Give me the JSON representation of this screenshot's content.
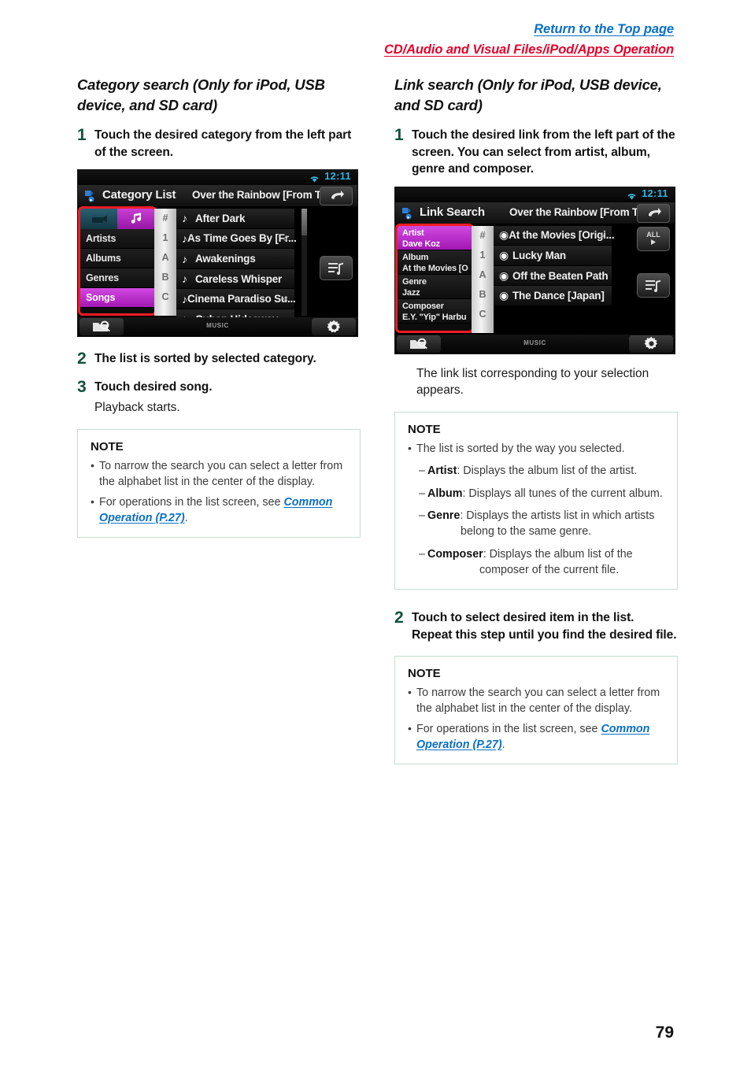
{
  "header": {
    "top_link": "Return to the Top page",
    "breadcrumb": "CD/Audio and Visual Files/iPod/Apps Operation"
  },
  "page_number": "79",
  "colors": {
    "link_blue": "#0b6fc4",
    "breadcrumb_red": "#e4002b",
    "step_number_green": "#12503c",
    "note_border_green": "#c9ddd0",
    "highlight_red": "#ee1c25",
    "device_accent_magenta": "#c93fd4"
  },
  "left_column": {
    "title": "Category search (Only for iPod, USB device, and SD card)",
    "steps": [
      {
        "num": "1",
        "text": "Touch the desired category from the left part of the screen."
      },
      {
        "num": "2",
        "text": "The list is sorted by selected category."
      },
      {
        "num": "3",
        "text": "Touch desired song.",
        "sub": "Playback starts."
      }
    ],
    "device": {
      "clock": "12:11",
      "title": "Category List",
      "now_playing": "Over the Rainbow [From T",
      "categories": [
        "Artists",
        "Albums",
        "Genres",
        "Songs"
      ],
      "selected_category": "Songs",
      "alphabet": [
        "#",
        "1",
        "A",
        "B",
        "C"
      ],
      "songs": [
        {
          "label": "After Dark",
          "chevron": false
        },
        {
          "label": "As Time Goes By [Fr...",
          "chevron": true
        },
        {
          "label": "Awakenings",
          "chevron": false
        },
        {
          "label": "Careless Whisper",
          "chevron": false
        },
        {
          "label": "Cinema Paradiso Su...",
          "chevron": true
        },
        {
          "label": "Cuban Hideaway",
          "chevron": false
        }
      ],
      "bottom_label": "MUSIC"
    },
    "note": {
      "title": "NOTE",
      "items": [
        {
          "text": "To narrow the search you can select a letter from the alphabet list in the center of the display."
        },
        {
          "pre": "For operations in the list screen, see ",
          "link": "Common Operation (P.27)",
          "post": "."
        }
      ]
    }
  },
  "right_column": {
    "title": "Link search (Only for iPod, USB device, and SD card)",
    "step1": {
      "num": "1",
      "text": "Touch the desired link from the left part of the screen. You can select from artist, album, genre and composer."
    },
    "after_device_text": "The link list corresponding to your selection appears.",
    "device": {
      "clock": "12:11",
      "title": "Link Search",
      "now_playing": "Over the Rainbow [From T",
      "links": [
        {
          "key": "Artist",
          "value": "Dave Koz",
          "selected": true
        },
        {
          "key": "Album",
          "value": "At the Movies [O",
          "selected": false
        },
        {
          "key": "Genre",
          "value": "Jazz",
          "selected": false
        },
        {
          "key": "Composer",
          "value": "E.Y. \"Yip\" Harbu",
          "selected": false
        }
      ],
      "alphabet": [
        "#",
        "1",
        "A",
        "B",
        "C"
      ],
      "items": [
        {
          "label": "At the Movies [Origi...",
          "chevron": true
        },
        {
          "label": "Lucky Man",
          "chevron": false
        },
        {
          "label": "Off the Beaten Path",
          "chevron": false
        },
        {
          "label": "The Dance [Japan]",
          "chevron": false
        }
      ],
      "all_button_label": "ALL",
      "bottom_label": "MUSIC"
    },
    "note1": {
      "title": "NOTE",
      "lead": "The list is sorted by the way you selected.",
      "subs": [
        {
          "term": "Artist",
          "desc": ": Displays the album list of the artist."
        },
        {
          "term": "Album",
          "desc": ": Displays all tunes of the current album."
        },
        {
          "term": "Genre",
          "desc": ": Displays the artists list in which artists",
          "desc2": "belong to the same genre."
        },
        {
          "term": "Composer",
          "desc": ": Displays the album list of the",
          "desc2": "composer of the current file."
        }
      ]
    },
    "step2": {
      "num": "2",
      "text": "Touch to select desired item in the list. Repeat this step until you find the desired file."
    },
    "note2": {
      "title": "NOTE",
      "items": [
        {
          "text": "To narrow the search you can select a letter from the alphabet list in the center of the display."
        },
        {
          "pre": "For operations in the list screen, see ",
          "link": "Common Operation (P.27)",
          "post": "."
        }
      ]
    }
  }
}
